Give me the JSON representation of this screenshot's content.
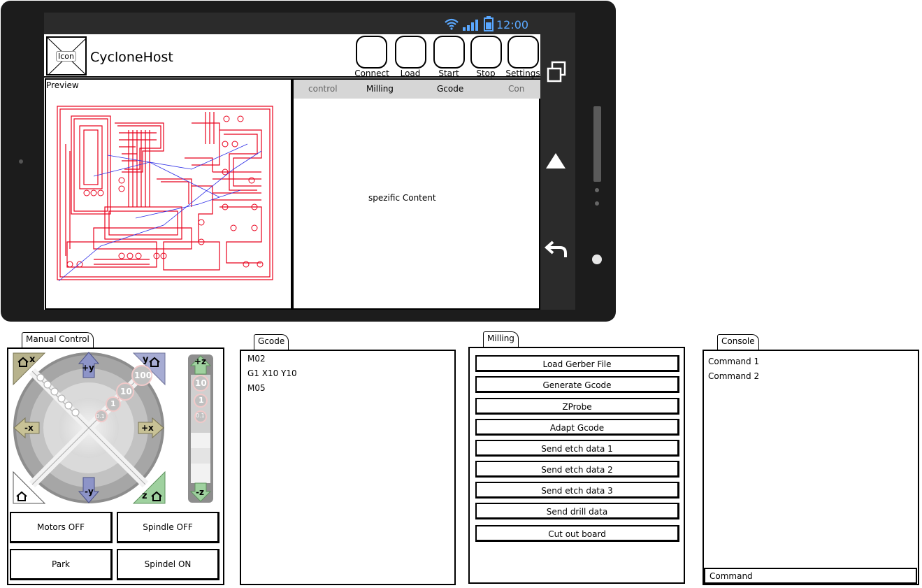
{
  "status_bar": {
    "time": "12:00"
  },
  "app": {
    "icon_label": "Icon",
    "title": "CycloneHost",
    "toolbar": [
      {
        "id": "connect",
        "label": "Connect"
      },
      {
        "id": "load",
        "label": "Load"
      },
      {
        "id": "start",
        "label": "Start"
      },
      {
        "id": "stop",
        "label": "Stop"
      },
      {
        "id": "settings",
        "label": "Settings"
      }
    ],
    "preview_label": "Preview",
    "tabs": [
      "control",
      "Milling",
      "Gcode",
      "Con"
    ],
    "content_text": "spezific Content"
  },
  "manual_control": {
    "tab": "Manual Control",
    "jog": {
      "plus_y": "+y",
      "minus_y": "-y",
      "minus_x": "-x",
      "plus_x": "+x",
      "plus_z": "+z",
      "minus_z": "-z",
      "home_x": "x",
      "home_y": "y",
      "home_z": "z",
      "steps": [
        "100",
        "10",
        "1",
        "0.1"
      ],
      "z_steps": [
        "10",
        "1",
        "0.1"
      ]
    },
    "buttons": {
      "motors_off": "Motors OFF",
      "spindle_off": "Spindle OFF",
      "park": "Park",
      "spindle_on": "Spindel ON"
    }
  },
  "gcode_panel": {
    "tab": "Gcode",
    "lines": [
      "M02",
      "G1 X10 Y10",
      "M05"
    ]
  },
  "milling_panel": {
    "tab": "Milling",
    "buttons": [
      "Load Gerber File",
      "Generate Gcode",
      "ZProbe",
      "Adapt Gcode",
      "Send etch data 1",
      "Send etch data 2",
      "Send etch data 3",
      "Send drill data",
      "Cut out board"
    ]
  },
  "console_panel": {
    "tab": "Console",
    "lines": [
      "Command 1",
      "Command 2"
    ],
    "input_placeholder": "Command"
  },
  "colors": {
    "phone_body": "#1c1c1c",
    "screen_bg": "#2b2b2b",
    "status_icons": "#5aa8ff",
    "pcb_trace": "#e8001c",
    "rats_nest": "#2e2ee6",
    "tab_strip": "#d6d6d6"
  }
}
